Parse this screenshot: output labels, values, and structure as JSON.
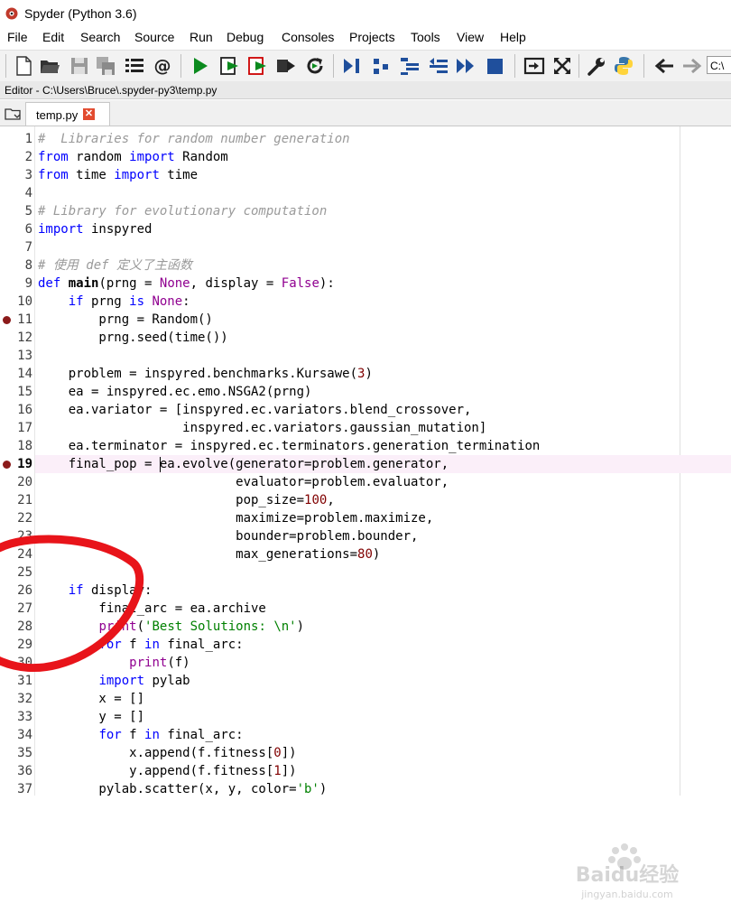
{
  "window": {
    "title": "Spyder (Python 3.6)"
  },
  "menu": [
    "File",
    "Edit",
    "Search",
    "Source",
    "Run",
    "Debug",
    "Consoles",
    "Projects",
    "Tools",
    "View",
    "Help"
  ],
  "toolbar": {
    "path_value": "C:\\",
    "icons": [
      "new-file-icon",
      "open-folder-icon",
      "save-icon",
      "save-all-icon",
      "outline-icon",
      "at-sign-icon",
      "run-icon",
      "run-cell-icon",
      "run-cell-advance-icon",
      "run-selection-icon",
      "rerun-icon",
      "debug-icon",
      "step-icon",
      "step-into-icon",
      "step-return-icon",
      "continue-icon",
      "stop-icon",
      "maximize-pane-icon",
      "fullscreen-icon",
      "preferences-icon",
      "python-path-icon",
      "back-arrow-icon",
      "forward-arrow-icon"
    ]
  },
  "editor": {
    "header": "Editor - C:\\Users\\Bruce\\.spyder-py3\\temp.py",
    "tab_label": "temp.py",
    "current_line": 19,
    "breakpoints": [
      11,
      19
    ],
    "lines": [
      [
        {
          "t": "#  Libraries for random number generation",
          "c": "cm"
        }
      ],
      [
        {
          "t": "from",
          "c": "kw"
        },
        {
          "t": " random "
        },
        {
          "t": "import",
          "c": "kw"
        },
        {
          "t": " Random"
        }
      ],
      [
        {
          "t": "from",
          "c": "kw"
        },
        {
          "t": " time "
        },
        {
          "t": "import",
          "c": "kw"
        },
        {
          "t": " time"
        }
      ],
      [],
      [
        {
          "t": "# Library for evolutionary computation",
          "c": "cm"
        }
      ],
      [
        {
          "t": "import",
          "c": "kw"
        },
        {
          "t": " inspyred"
        }
      ],
      [],
      [
        {
          "t": "# 使用 def 定义了主函数",
          "c": "cm"
        }
      ],
      [
        {
          "t": "def",
          "c": "kw"
        },
        {
          "t": " "
        },
        {
          "t": "main",
          "c": "fn"
        },
        {
          "t": "(prng = "
        },
        {
          "t": "None",
          "c": "bi"
        },
        {
          "t": ", display = "
        },
        {
          "t": "False",
          "c": "bi"
        },
        {
          "t": "):"
        }
      ],
      [
        {
          "t": "    "
        },
        {
          "t": "if",
          "c": "kw"
        },
        {
          "t": " prng "
        },
        {
          "t": "is",
          "c": "kw"
        },
        {
          "t": " "
        },
        {
          "t": "None",
          "c": "bi"
        },
        {
          "t": ":"
        }
      ],
      [
        {
          "t": "        prng = Random()"
        }
      ],
      [
        {
          "t": "        prng.seed(time())"
        }
      ],
      [],
      [
        {
          "t": "    problem = inspyred.benchmarks.Kursawe("
        },
        {
          "t": "3",
          "c": "nm"
        },
        {
          "t": ")"
        }
      ],
      [
        {
          "t": "    ea = inspyred.ec.emo.NSGA2(prng)"
        }
      ],
      [
        {
          "t": "    ea.variator = [inspyred.ec.variators.blend_crossover,"
        }
      ],
      [
        {
          "t": "                   inspyred.ec.variators.gaussian_mutation]"
        }
      ],
      [
        {
          "t": "    ea.terminator = inspyred.ec.terminators.generation_termination"
        }
      ],
      [
        {
          "t": "    final_pop = ea.evolve(generator=problem.generator,"
        }
      ],
      [
        {
          "t": "                          evaluator=problem.evaluator,"
        }
      ],
      [
        {
          "t": "                          pop_size="
        },
        {
          "t": "100",
          "c": "nm"
        },
        {
          "t": ","
        }
      ],
      [
        {
          "t": "                          maximize=problem.maximize,"
        }
      ],
      [
        {
          "t": "                          bounder=problem.bounder,"
        }
      ],
      [
        {
          "t": "                          max_generations="
        },
        {
          "t": "80",
          "c": "nm"
        },
        {
          "t": ")"
        }
      ],
      [],
      [
        {
          "t": "    "
        },
        {
          "t": "if",
          "c": "kw"
        },
        {
          "t": " display:"
        }
      ],
      [
        {
          "t": "        final_arc = ea.archive"
        }
      ],
      [
        {
          "t": "        "
        },
        {
          "t": "print",
          "c": "bi"
        },
        {
          "t": "("
        },
        {
          "t": "'Best Solutions: \\n'",
          "c": "st"
        },
        {
          "t": ")"
        }
      ],
      [
        {
          "t": "        "
        },
        {
          "t": "for",
          "c": "kw"
        },
        {
          "t": " f "
        },
        {
          "t": "in",
          "c": "kw"
        },
        {
          "t": " final_arc:"
        }
      ],
      [
        {
          "t": "            "
        },
        {
          "t": "print",
          "c": "bi"
        },
        {
          "t": "(f)"
        }
      ],
      [
        {
          "t": "        "
        },
        {
          "t": "import",
          "c": "kw"
        },
        {
          "t": " pylab"
        }
      ],
      [
        {
          "t": "        x = []"
        }
      ],
      [
        {
          "t": "        y = []"
        }
      ],
      [
        {
          "t": "        "
        },
        {
          "t": "for",
          "c": "kw"
        },
        {
          "t": " f "
        },
        {
          "t": "in",
          "c": "kw"
        },
        {
          "t": " final_arc:"
        }
      ],
      [
        {
          "t": "            x.append(f.fitness["
        },
        {
          "t": "0",
          "c": "nm"
        },
        {
          "t": "])"
        }
      ],
      [
        {
          "t": "            y.append(f.fitness["
        },
        {
          "t": "1",
          "c": "nm"
        },
        {
          "t": "])"
        }
      ],
      [
        {
          "t": "        pylab.scatter(x, y, color="
        },
        {
          "t": "'b'",
          "c": "st"
        },
        {
          "t": ")"
        }
      ]
    ]
  },
  "watermark": {
    "brand": "Baidu经验",
    "url": "jingyan.baidu.com"
  },
  "colors": {
    "annotation": "#e8141a",
    "breakpoint": "#8b1a1a",
    "keyword": "#0000ff",
    "comment": "#9a9a9a",
    "string": "#008000",
    "number": "#800000",
    "builtin": "#900090"
  }
}
